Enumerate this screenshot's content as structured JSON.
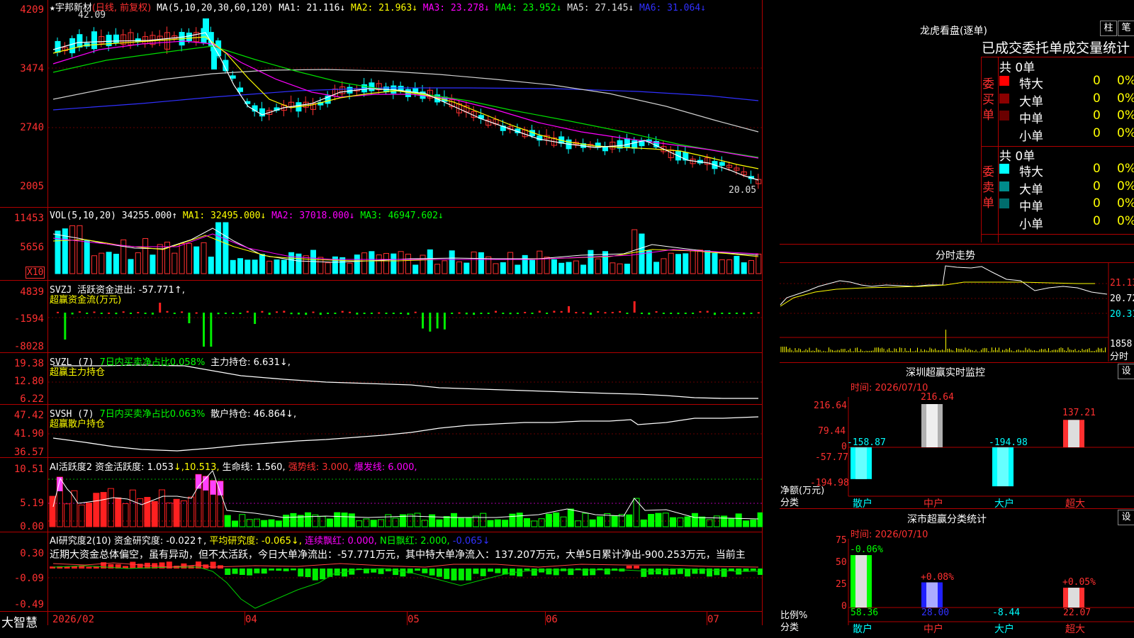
{
  "app": {
    "brand": "大智慧",
    "star": "★",
    "stock": "宇邦新材",
    "mode": "(日线, 前复权)",
    "high_label": "42.09",
    "low_label": "20.05"
  },
  "ma_line": {
    "ma_head": "MA(5,10,20,30,60,120)",
    "ma1": "MA1: 21.116↓",
    "ma2": "MA2: 21.963↓",
    "ma3": "MA3: 23.278↓",
    "ma4": "MA4: 23.952↓",
    "ma5": "MA5: 27.145↓",
    "ma6": "MA6: 31.064↓"
  },
  "price_axis": [
    "4209",
    "3474",
    "2740",
    "2005"
  ],
  "vol": {
    "head": "VOL(5,10,20)",
    "value": "34255.000↑",
    "ma1": "MA1: 32495.000↓",
    "ma2": "MA2: 37018.000↓",
    "ma3": "MA3: 46947.602↓",
    "axis": [
      "11453",
      "5656"
    ],
    "unit": "X10"
  },
  "svzj": {
    "head": "SVZJ",
    "label": "活跃资金进出: -57.771↑,",
    "sub": "超赢资金流(万元)",
    "axis": [
      "4839",
      "-1594",
      "-8028"
    ]
  },
  "svzl": {
    "head": "SVZL (7)",
    "ratio": "7日内买卖净占比0.058%",
    "hold": "主力持仓: 6.631↓,",
    "sub": "超赢主力持仓",
    "axis": [
      "19.38",
      "12.80",
      "6.22"
    ]
  },
  "svsh": {
    "head": "SVSH (7)",
    "ratio": "7日内买卖净占比0.063%",
    "hold": "散户持仓: 46.864↓,",
    "sub": "超赢散户持仓",
    "axis": [
      "47.42",
      "41.90",
      "36.57"
    ]
  },
  "ai1": {
    "head": "AI活跃度2",
    "a": "资金活跃度: 1.053",
    "b": "↓,10.513,",
    "c": "生命线: 1.560,",
    "d": "强势线: 3.000,",
    "e": "爆发线: 6.000,",
    "axis": [
      "10.51",
      "5.19",
      "0.00"
    ]
  },
  "ai2": {
    "head": "AI研究度2(10)",
    "a": "资金研究度: -0.022↑,",
    "b": "平均研究度: -0.065↓,",
    "c": "连续飘红: 0.000,",
    "d": "N日飘红: 2.000,",
    "e": "-0.065↓",
    "axis": [
      "0.30",
      "-0.09",
      "-0.49"
    ],
    "comment": "近期大资金总体偏空，虽有异动，但不太活跃，今日大单净流出：-57.771万元，其中特大单净流入：137.207万元，大单5日累计净出-900.253万元，当前主"
  },
  "dates": [
    "2026/02",
    "04",
    "05",
    "06",
    "07"
  ],
  "lhb": {
    "title": "龙虎看盘(逐单)",
    "btn1": "柱",
    "btn2": "笔",
    "tabs": "已成交委托单成交量统计",
    "buy": {
      "side": "委买单",
      "total": "共 0单",
      "rows": [
        {
          "name": "特大",
          "color": "#ff0000",
          "val": "0",
          "pct": "0%"
        },
        {
          "name": "大单",
          "color": "#8b0000",
          "val": "0",
          "pct": "0%"
        },
        {
          "name": "中单",
          "color": "#6a0000",
          "val": "0",
          "pct": "0%"
        },
        {
          "name": "小单",
          "color": "#000000",
          "val": "0",
          "pct": "0%"
        }
      ]
    },
    "sell": {
      "side": "委卖单",
      "total": "共 0单",
      "rows": [
        {
          "name": "特大",
          "color": "#00ffff",
          "val": "0",
          "pct": "0%"
        },
        {
          "name": "大单",
          "color": "#008b8b",
          "val": "0",
          "pct": "0%"
        },
        {
          "name": "中单",
          "color": "#006d6d",
          "val": "0",
          "pct": "0%"
        },
        {
          "name": "小单",
          "color": "#000000",
          "val": "0",
          "pct": "0%"
        }
      ]
    }
  },
  "fenshi": {
    "title": "分时走势",
    "p1": "21.13",
    "p2": "20.72",
    "p3": "20.31",
    "vol": "1858",
    "unit": "分时"
  },
  "sz_mon": {
    "title": "深圳超赢实时监控",
    "btn": "设",
    "time": "时间: 2026/07/10",
    "axis": [
      "216.64",
      "79.44",
      "0",
      "-57.77",
      "-194.98"
    ],
    "ylabel": "净额(万元)",
    "xlabel": "分类",
    "cats": [
      "散户",
      "中户",
      "大户",
      "超大"
    ],
    "vals": [
      "-158.87",
      "216.64",
      "-194.98",
      "137.21"
    ]
  },
  "sz_cls": {
    "title": "深市超赢分类统计",
    "btn": "设",
    "time": "时间: 2026/07/10",
    "axis": [
      "75",
      "50",
      "25",
      "0"
    ],
    "ylabel": "比例%",
    "xlabel": "分类",
    "cats": [
      "散户",
      "中户",
      "大户",
      "超大"
    ],
    "pcts": [
      "-0.06%",
      "+0.08%",
      "",
      "+0.05%"
    ],
    "vals": [
      "58.36",
      "28.00",
      "-8.44",
      "22.07"
    ]
  },
  "colors": {
    "red": "#ff3030",
    "cyan": "#00ffff",
    "green": "#00ff00",
    "magenta": "#ff00ff",
    "yellow": "#ffff00",
    "border": "#b00000"
  },
  "chart_data": [
    {
      "type": "bar",
      "title": "深圳超赢实时监控",
      "categories": [
        "散户",
        "中户",
        "大户",
        "超大"
      ],
      "values": [
        -158.87,
        216.64,
        -194.98,
        137.21
      ],
      "ylabel": "净额(万元)",
      "ylim": [
        -194.98,
        216.64
      ]
    },
    {
      "type": "bar",
      "title": "深市超赢分类统计",
      "categories": [
        "散户",
        "中户",
        "大户",
        "超大"
      ],
      "values": [
        58.36,
        28.0,
        -8.44,
        22.07
      ],
      "ylabel": "比例%",
      "ylim": [
        0,
        75
      ]
    }
  ]
}
